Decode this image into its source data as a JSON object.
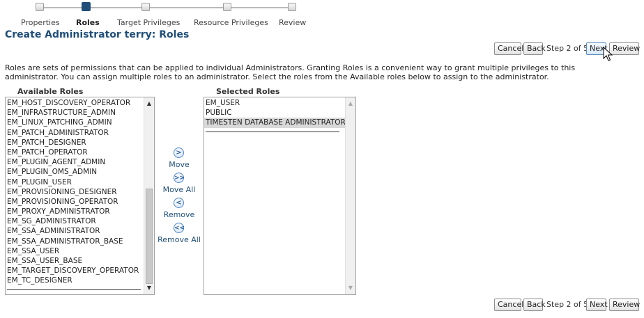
{
  "train": {
    "steps": [
      {
        "label": "Properties",
        "active": false
      },
      {
        "label": "Roles",
        "active": true
      },
      {
        "label": "Target Privileges",
        "active": false
      },
      {
        "label": "Resource Privileges",
        "active": false
      },
      {
        "label": "Review",
        "active": false
      }
    ]
  },
  "page": {
    "title": "Create Administrator terry: Roles",
    "description": "Roles are sets of permissions that can be applied to individual Administrators. Granting Roles is a convenient way to grant multiple privileges to this administrator. You can assign multiple roles to an administrator. Select the roles from the Available roles below to assign to the administrator."
  },
  "nav_top": {
    "cancel": "Cancel",
    "back": "Back",
    "step_info": "Step 2 of 5",
    "next": "Next",
    "review": "Review"
  },
  "nav_bottom": {
    "cancel": "Cancel",
    "back": "Back",
    "step_info": "Step 2 of 5",
    "next": "Next",
    "review": "Review"
  },
  "available_roles": {
    "header": "Available Roles",
    "items": [
      "EM_HOST_DISCOVERY_OPERATOR",
      "EM_INFRASTRUCTURE_ADMIN",
      "EM_LINUX_PATCHING_ADMIN",
      "EM_PATCH_ADMINISTRATOR",
      "EM_PATCH_DESIGNER",
      "EM_PATCH_OPERATOR",
      "EM_PLUGIN_AGENT_ADMIN",
      "EM_PLUGIN_OMS_ADMIN",
      "EM_PLUGIN_USER",
      "EM_PROVISIONING_DESIGNER",
      "EM_PROVISIONING_OPERATOR",
      "EM_PROXY_ADMINISTRATOR",
      "EM_SG_ADMINISTRATOR",
      "EM_SSA_ADMINISTRATOR",
      "EM_SSA_ADMINISTRATOR_BASE",
      "EM_SSA_USER",
      "EM_SSA_USER_BASE",
      "EM_TARGET_DISCOVERY_OPERATOR",
      "EM_TC_DESIGNER"
    ]
  },
  "selected_roles": {
    "header": "Selected Roles",
    "items": [
      {
        "label": "EM_USER",
        "selected": false
      },
      {
        "label": "PUBLIC",
        "selected": false
      },
      {
        "label": "TIMESTEN DATABASE ADMINISTRATORS",
        "selected": true
      }
    ]
  },
  "shuttle": {
    "move": "Move",
    "move_all": "Move All",
    "remove": "Remove",
    "remove_all": "Remove All"
  },
  "icons": {
    "move": "move-right-icon",
    "move_all": "move-all-right-icon",
    "remove": "move-left-icon",
    "remove_all": "move-all-left-icon",
    "cursor": "mouse-pointer-icon"
  },
  "colors": {
    "title": "#1f4e79",
    "active_step": "#1f4e79",
    "selected_item_bg": "#d9d9d9",
    "link": "#1f4e79"
  }
}
